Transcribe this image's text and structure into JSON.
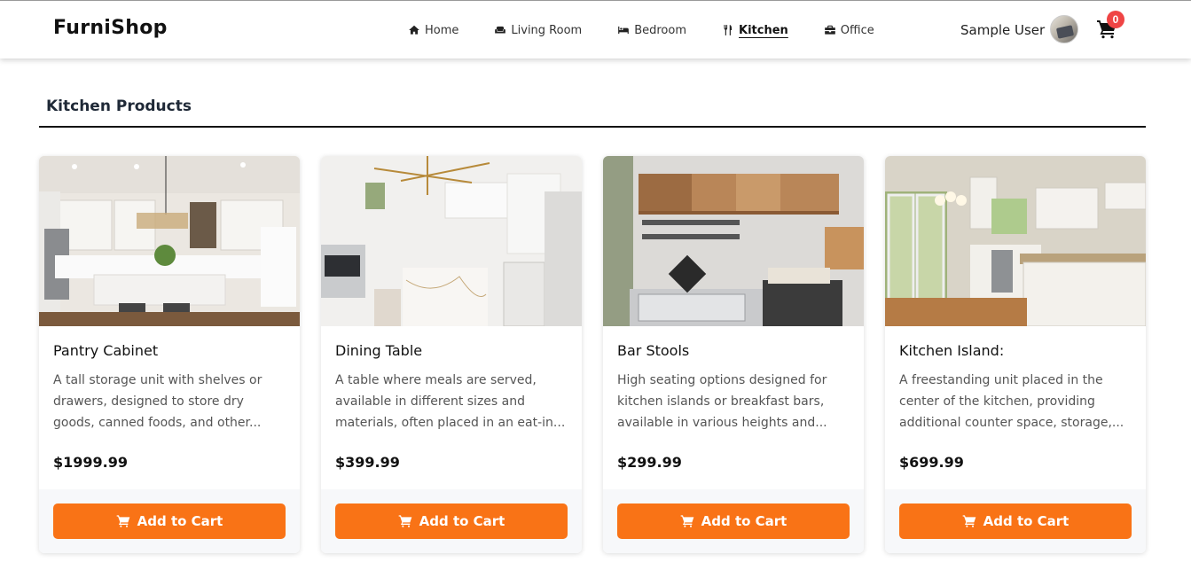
{
  "brand": "FurniShop",
  "nav": [
    {
      "label": "Home",
      "icon": "home-icon"
    },
    {
      "label": "Living Room",
      "icon": "couch-icon"
    },
    {
      "label": "Bedroom",
      "icon": "bed-icon"
    },
    {
      "label": "Kitchen",
      "icon": "utensils-icon",
      "active": true
    },
    {
      "label": "Office",
      "icon": "briefcase-icon"
    }
  ],
  "user": {
    "name": "Sample User"
  },
  "cart": {
    "count": "0"
  },
  "section": {
    "title": "Kitchen Products"
  },
  "colors": {
    "accent": "#f97316",
    "badge": "#ef4444"
  },
  "products": [
    {
      "name": "Pantry Cabinet",
      "description": "A tall storage unit with shelves or drawers, designed to store dry goods, canned foods, and other...",
      "price": "$1999.99",
      "button": "Add to Cart"
    },
    {
      "name": "Dining Table",
      "description": "A table where meals are served, available in different sizes and materials, often placed in an eat-in...",
      "price": "$399.99",
      "button": "Add to Cart"
    },
    {
      "name": "Bar Stools",
      "description": "High seating options designed for kitchen islands or breakfast bars, available in various heights and...",
      "price": "$299.99",
      "button": "Add to Cart"
    },
    {
      "name": "Kitchen Island:",
      "description": "A freestanding unit placed in the center of the kitchen, providing additional counter space, storage,...",
      "price": "$699.99",
      "button": "Add to Cart"
    }
  ]
}
